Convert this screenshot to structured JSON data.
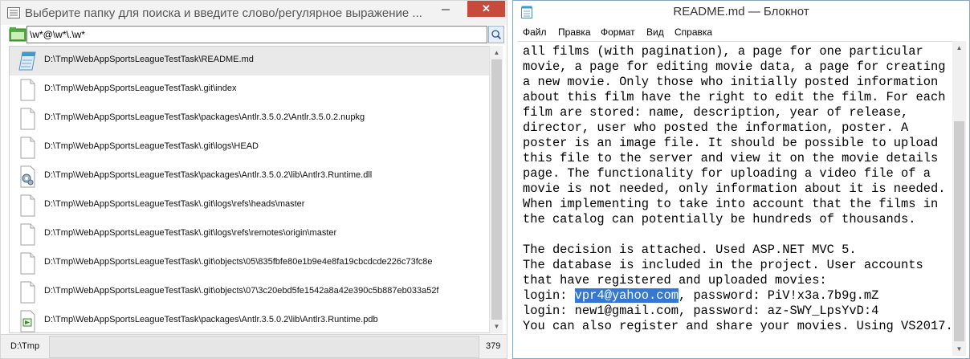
{
  "search_window": {
    "title": "Выберите папку для поиска и введите слово/регулярное выражение ...",
    "close_label": "✕",
    "search": {
      "value": "\\w*@\\w*\\.\\w*",
      "placeholder": ""
    },
    "files": [
      {
        "path": "D:\\Tmp\\WebAppSportsLeagueTestTask\\README.md",
        "icon": "notepad-icon",
        "selected": true
      },
      {
        "path": "D:\\Tmp\\WebAppSportsLeagueTestTask\\.git\\index",
        "icon": "blank-file-icon"
      },
      {
        "path": "D:\\Tmp\\WebAppSportsLeagueTestTask\\packages\\Antlr.3.5.0.2\\Antlr.3.5.0.2.nupkg",
        "icon": "blank-file-icon"
      },
      {
        "path": "D:\\Tmp\\WebAppSportsLeagueTestTask\\.git\\logs\\HEAD",
        "icon": "blank-file-icon"
      },
      {
        "path": "D:\\Tmp\\WebAppSportsLeagueTestTask\\packages\\Antlr.3.5.0.2\\lib\\Antlr3.Runtime.dll",
        "icon": "dll-gear-icon"
      },
      {
        "path": "D:\\Tmp\\WebAppSportsLeagueTestTask\\.git\\logs\\refs\\heads\\master",
        "icon": "blank-file-icon"
      },
      {
        "path": "D:\\Tmp\\WebAppSportsLeagueTestTask\\.git\\logs\\refs\\remotes\\origin\\master",
        "icon": "blank-file-icon"
      },
      {
        "path": "D:\\Tmp\\WebAppSportsLeagueTestTask\\.git\\objects\\05\\835fbfe80e1b9e4e8fa19cbcdcde226c73fc8e",
        "icon": "blank-file-icon"
      },
      {
        "path": "D:\\Tmp\\WebAppSportsLeagueTestTask\\.git\\objects\\07\\3c20ebd5fe1542a8a42e390c5b887eb033a52f",
        "icon": "blank-file-icon"
      },
      {
        "path": "D:\\Tmp\\WebAppSportsLeagueTestTask\\packages\\Antlr.3.5.0.2\\lib\\Antlr3.Runtime.pdb",
        "icon": "pdb-file-icon"
      }
    ],
    "status": {
      "path": "D:\\Tmp",
      "count": "379"
    }
  },
  "notepad": {
    "title": "README.md — Блокнот",
    "menu": [
      "Файл",
      "Правка",
      "Формат",
      "Вид",
      "Справка"
    ],
    "text_lines": [
      "all films (with pagination), a page for one particular",
      "movie, a page for editing movie data, a page for creating",
      "a new movie. Only those who initially posted information",
      "about this film have the right to edit the film. For each",
      "film are stored: name, description, year of release,",
      "director, user who posted the information, poster. A",
      "poster is an image file. It should be possible to upload",
      "this file to the server and view it on the movie details",
      "page. The functionality for uploading a video file of a",
      "movie is not needed, only information about it is needed.",
      "When implementing to take into account that the films in",
      "the catalog can potentially be hundreds of thousands.",
      "",
      "The decision is attached. Used ASP.NET MVC 5.",
      "The database is included in the project. User accounts",
      "that have registered and uploaded movies:"
    ],
    "login1": {
      "prefix": "login: ",
      "email": "vpr4@yahoo.com",
      "suffix": ", password: PiV!x3a.7b9g.mZ"
    },
    "login2": "login: new1@gmail.com, password: az-SWY_LpsYvD:4",
    "last_line": "You can also register and share your movies. Using VS2017."
  },
  "colors": {
    "selection": "#3478d4",
    "close_button": "#c74b3c"
  }
}
